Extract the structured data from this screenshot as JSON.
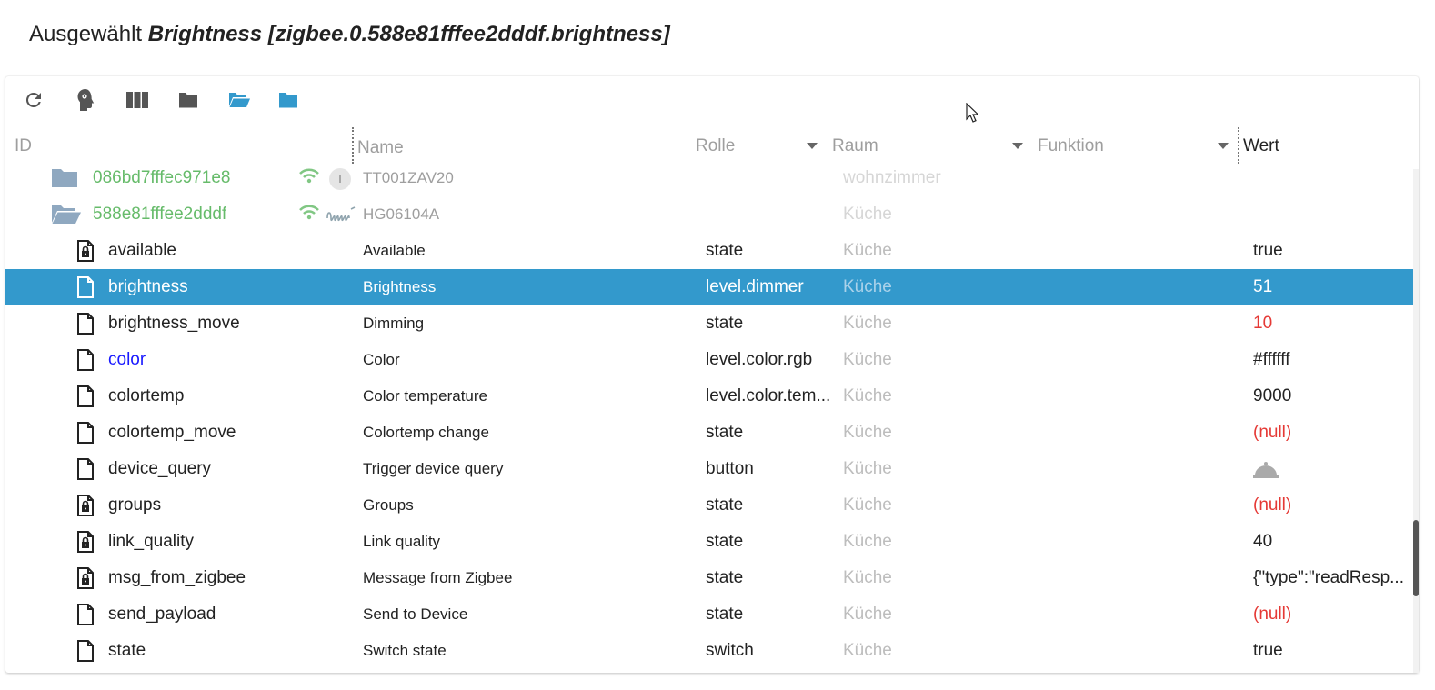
{
  "title": {
    "prefix": "Ausgewählt",
    "selected": "Brightness [zigbee.0.588e81fffee2dddf.brightness]"
  },
  "toolbar": {
    "buttons": [
      "refresh-icon",
      "expert-mode-icon",
      "columns-icon",
      "folder-icon",
      "folder-open-icon",
      "folder-blue-icon"
    ],
    "accent": "#3399cc"
  },
  "columns": {
    "id": "ID",
    "name": "Name",
    "role": "Rolle",
    "room": "Raum",
    "function": "Funktion",
    "value": "Wert"
  },
  "folders": [
    {
      "id": "086bd7fffec971e8",
      "name": "TT001ZAV20",
      "room": "wohnzimmer",
      "open": false
    },
    {
      "id": "588e81fffee2dddf",
      "name": "HG06104A",
      "room": "Küche",
      "open": true
    }
  ],
  "states": [
    {
      "id": "available",
      "name": "Available",
      "role": "state",
      "room": "Küche",
      "value": "true",
      "locked": true,
      "value_style": "normal"
    },
    {
      "id": "brightness",
      "name": "Brightness",
      "role": "level.dimmer",
      "room": "Küche",
      "value": "51",
      "locked": false,
      "selected": true,
      "value_style": "normal"
    },
    {
      "id": "brightness_move",
      "name": "Dimming",
      "role": "state",
      "room": "Küche",
      "value": "10",
      "locked": false,
      "value_style": "red"
    },
    {
      "id": "color",
      "name": "Color",
      "role": "level.color.rgb",
      "room": "Küche",
      "value": "#ffffff",
      "locked": false,
      "id_style": "blue",
      "value_style": "normal"
    },
    {
      "id": "colortemp",
      "name": "Color temperature",
      "role": "level.color.tem...",
      "room": "Küche",
      "value": "9000",
      "locked": false,
      "value_style": "normal"
    },
    {
      "id": "colortemp_move",
      "name": "Colortemp change",
      "role": "state",
      "room": "Küche",
      "value": "(null)",
      "locked": false,
      "value_style": "red"
    },
    {
      "id": "device_query",
      "name": "Trigger device query",
      "role": "button",
      "room": "Küche",
      "value": "",
      "locked": false,
      "value_style": "button"
    },
    {
      "id": "groups",
      "name": "Groups",
      "role": "state",
      "room": "Küche",
      "value": "(null)",
      "locked": true,
      "value_style": "red"
    },
    {
      "id": "link_quality",
      "name": "Link quality",
      "role": "state",
      "room": "Küche",
      "value": "40",
      "locked": true,
      "value_style": "normal"
    },
    {
      "id": "msg_from_zigbee",
      "name": "Message from Zigbee",
      "role": "state",
      "room": "Küche",
      "value": "{\"type\":\"readResp...",
      "locked": true,
      "value_style": "normal"
    },
    {
      "id": "send_payload",
      "name": "Send to Device",
      "role": "state",
      "room": "Küche",
      "value": "(null)",
      "locked": false,
      "value_style": "red"
    },
    {
      "id": "state",
      "name": "Switch state",
      "role": "switch",
      "room": "Küche",
      "value": "true",
      "locked": false,
      "value_style": "normal"
    }
  ]
}
